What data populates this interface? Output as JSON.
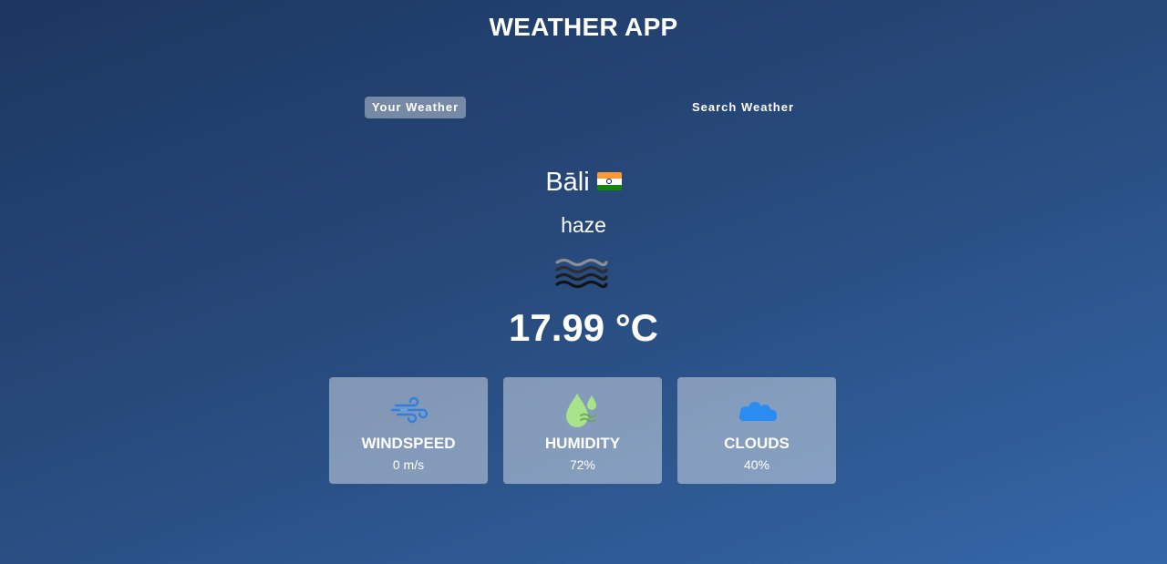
{
  "app": {
    "title": "WEATHER APP"
  },
  "tabs": [
    {
      "label": "Your Weather",
      "active": true
    },
    {
      "label": "Search Weather",
      "active": false
    }
  ],
  "location": {
    "city": "Bāli",
    "flag_icon": "india-flag-icon"
  },
  "weather": {
    "description": "haze",
    "icon": "haze-icon",
    "temperature": "17.99 °C"
  },
  "stats": {
    "windspeed": {
      "label": "WINDSPEED",
      "value": "0 m/s",
      "icon": "wind-icon"
    },
    "humidity": {
      "label": "HUMIDITY",
      "value": "72%",
      "icon": "humidity-icon"
    },
    "clouds": {
      "label": "CLOUDS",
      "value": "40%",
      "icon": "cloud-icon"
    }
  },
  "colors": {
    "background_top": "#1c3761",
    "background_bottom": "#3467a8",
    "wind_icon": "#2f7fe0",
    "humidity_icon": "#a8e38a",
    "cloud_icon": "#2a8cf0"
  }
}
